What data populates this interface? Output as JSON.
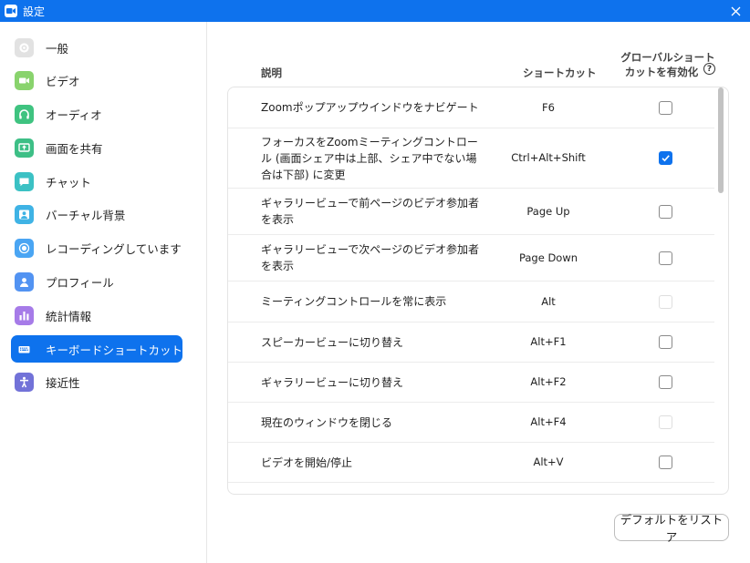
{
  "window": {
    "title": "設定"
  },
  "colors": {
    "accent": "#0e72ed"
  },
  "sidebar": {
    "items": [
      {
        "label": "一般",
        "icon": "gear-icon",
        "color": "#e2e2e2",
        "active": false
      },
      {
        "label": "ビデオ",
        "icon": "video-camera-icon",
        "color": "#89d36d",
        "active": false
      },
      {
        "label": "オーディオ",
        "icon": "headphones-icon",
        "color": "#3fc380",
        "active": false
      },
      {
        "label": "画面を共有",
        "icon": "share-screen-icon",
        "color": "#3dbf86",
        "active": false
      },
      {
        "label": "チャット",
        "icon": "chat-bubble-icon",
        "color": "#3bc1c4",
        "active": false
      },
      {
        "label": "バーチャル背景",
        "icon": "virtual-background-icon",
        "color": "#3fb3e5",
        "active": false
      },
      {
        "label": "レコーディングしています",
        "icon": "record-icon",
        "color": "#4aa5f3",
        "active": false
      },
      {
        "label": "プロフィール",
        "icon": "profile-icon",
        "color": "#5293f2",
        "active": false
      },
      {
        "label": "統計情報",
        "icon": "statistics-icon",
        "color": "#a67be8",
        "active": false
      },
      {
        "label": "キーボードショートカット",
        "icon": "keyboard-icon",
        "color": "#0e72ed",
        "active": true
      },
      {
        "label": "接近性",
        "icon": "accessibility-icon",
        "color": "#7272d8",
        "active": false
      }
    ]
  },
  "shortcuts": {
    "headers": {
      "description": "説明",
      "shortcut": "ショートカット",
      "global_line1": "グローバルショート",
      "global_line2": "カットを有効化"
    },
    "rows": [
      {
        "description": "Zoomポップアップウインドウをナビゲート",
        "key": "F6",
        "global": "unchecked"
      },
      {
        "description": "フォーカスをZoomミーティングコントロール (画面シェア中は上部、シェア中でない場合は下部) に変更",
        "key": "Ctrl+Alt+Shift",
        "global": "checked"
      },
      {
        "description": "ギャラリービューで前ページのビデオ参加者を表示",
        "key": "Page Up",
        "global": "unchecked"
      },
      {
        "description": "ギャラリービューで次ページのビデオ参加者を表示",
        "key": "Page Down",
        "global": "unchecked"
      },
      {
        "description": "ミーティングコントロールを常に表示",
        "key": "Alt",
        "global": "disabled"
      },
      {
        "description": "スピーカービューに切り替え",
        "key": "Alt+F1",
        "global": "unchecked"
      },
      {
        "description": "ギャラリービューに切り替え",
        "key": "Alt+F2",
        "global": "unchecked"
      },
      {
        "description": "現在のウィンドウを閉じる",
        "key": "Alt+F4",
        "global": "disabled"
      },
      {
        "description": "ビデオを開始/停止",
        "key": "Alt+V",
        "global": "unchecked"
      }
    ]
  },
  "buttons": {
    "reset": "デフォルトをリストア"
  }
}
